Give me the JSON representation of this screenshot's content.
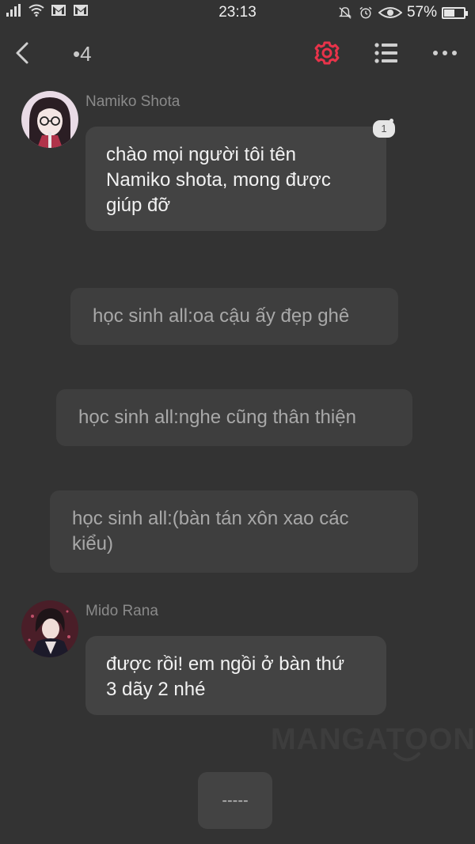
{
  "status_bar": {
    "time": "23:13",
    "battery_text": "57%",
    "battery_level": 0.57,
    "left_icons": [
      "signal-icon",
      "wifi-icon",
      "gmail-icon",
      "gmail-icon"
    ],
    "right_icons": [
      "bell-off-icon",
      "alarm-icon",
      "eye-icon",
      "battery-icon"
    ]
  },
  "nav": {
    "count": "•4",
    "accent_color": "#e8334a"
  },
  "messages": [
    {
      "sender": "Namiko Shota",
      "text_lines": [
        "chào mọi người tôi tên",
        "Namiko shota, mong được",
        "giúp đỡ"
      ],
      "badge": "1"
    },
    {
      "sender": "Mido Rana",
      "text_lines": [
        "được rồi! em ngồi ở bàn thứ",
        "3 dãy 2 nhé"
      ]
    }
  ],
  "narrations": [
    {
      "lines": [
        "học sinh all:oa cậu ấy đẹp ghê"
      ]
    },
    {
      "lines": [
        "học sinh all:nghe cũng thân thiện"
      ]
    },
    {
      "lines": [
        "học sinh all:(bàn tán xôn xao các",
        "kiểu)"
      ]
    }
  ],
  "watermark": "MANGATOON",
  "bottom_button": "-----"
}
